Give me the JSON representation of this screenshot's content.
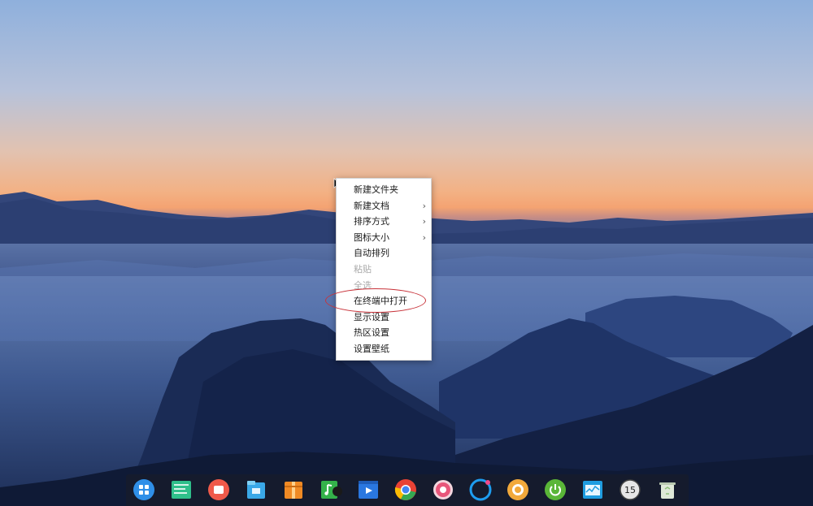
{
  "desktop": {
    "wallpaper": "mountain-sunset-wallpaper"
  },
  "context_menu": {
    "items": [
      {
        "label": "新建文件夹",
        "disabled": false,
        "submenu": false
      },
      {
        "label": "新建文档",
        "disabled": false,
        "submenu": true
      },
      {
        "label": "排序方式",
        "disabled": false,
        "submenu": true
      },
      {
        "label": "图标大小",
        "disabled": false,
        "submenu": true
      },
      {
        "label": "自动排列",
        "disabled": false,
        "submenu": false
      },
      {
        "label": "粘贴",
        "disabled": true,
        "submenu": false
      },
      {
        "label": "全选",
        "disabled": true,
        "submenu": false
      },
      {
        "label": "在终端中打开",
        "disabled": false,
        "submenu": false,
        "highlighted": true
      },
      {
        "label": "显示设置",
        "disabled": false,
        "submenu": false
      },
      {
        "label": "热区设置",
        "disabled": false,
        "submenu": false
      },
      {
        "label": "设置壁纸",
        "disabled": false,
        "submenu": false
      }
    ],
    "submenu_arrow": "›"
  },
  "dock": {
    "items": [
      {
        "name": "launcher-icon",
        "color": "#2f8fe8"
      },
      {
        "name": "deepin-store-icon",
        "color": "#2fbf8a"
      },
      {
        "name": "screen-recorder-icon",
        "color": "#f05a4a"
      },
      {
        "name": "file-manager-icon",
        "color": "#3aa8e8"
      },
      {
        "name": "archive-manager-icon",
        "color": "#f08a24"
      },
      {
        "name": "music-icon",
        "color": "#34b24a"
      },
      {
        "name": "movie-icon",
        "color": "#2a77e0"
      },
      {
        "name": "chrome-icon",
        "color": "#e94235"
      },
      {
        "name": "settings-icon",
        "color": "#e8567a"
      },
      {
        "name": "deepin-cloud-icon",
        "color": "#1e9df0"
      },
      {
        "name": "deepin-browser-icon",
        "color": "#f2a93b"
      },
      {
        "name": "power-icon",
        "color": "#5ab638"
      },
      {
        "name": "system-monitor-icon",
        "color": "#1f9ce0"
      },
      {
        "name": "clock-icon",
        "color": "#e6e6e6"
      },
      {
        "name": "trash-icon",
        "color": "#8fbf7a"
      }
    ],
    "clock_text": "15"
  }
}
